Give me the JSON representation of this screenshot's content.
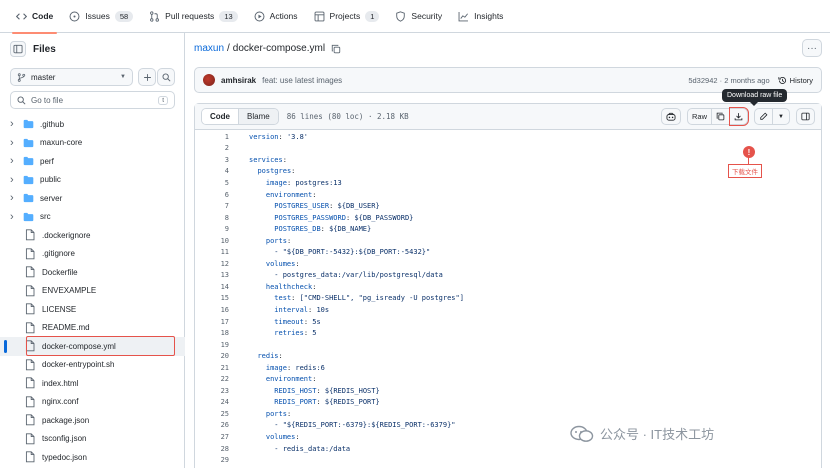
{
  "tabs": [
    {
      "label": "Code",
      "icon": "code-icon",
      "selected": true
    },
    {
      "label": "Issues",
      "icon": "issue-icon",
      "count": "58"
    },
    {
      "label": "Pull requests",
      "icon": "pull-request-icon",
      "count": "13"
    },
    {
      "label": "Actions",
      "icon": "play-icon"
    },
    {
      "label": "Projects",
      "icon": "table-icon",
      "count": "1"
    },
    {
      "label": "Security",
      "icon": "shield-icon"
    },
    {
      "label": "Insights",
      "icon": "graph-icon"
    }
  ],
  "sidebar": {
    "title": "Files",
    "branch": "master",
    "goto_placeholder": "Go to file",
    "goto_shortcut": "t",
    "items": [
      {
        "name": ".github",
        "type": "dir"
      },
      {
        "name": "maxun-core",
        "type": "dir"
      },
      {
        "name": "perf",
        "type": "dir"
      },
      {
        "name": "public",
        "type": "dir"
      },
      {
        "name": "server",
        "type": "dir"
      },
      {
        "name": "src",
        "type": "dir"
      },
      {
        "name": ".dockerignore",
        "type": "file"
      },
      {
        "name": ".gitignore",
        "type": "file"
      },
      {
        "name": "Dockerfile",
        "type": "file"
      },
      {
        "name": "ENVEXAMPLE",
        "type": "file"
      },
      {
        "name": "LICENSE",
        "type": "file"
      },
      {
        "name": "README.md",
        "type": "file"
      },
      {
        "name": "docker-compose.yml",
        "type": "file",
        "active": true
      },
      {
        "name": "docker-entrypoint.sh",
        "type": "file"
      },
      {
        "name": "index.html",
        "type": "file"
      },
      {
        "name": "nginx.conf",
        "type": "file"
      },
      {
        "name": "package.json",
        "type": "file"
      },
      {
        "name": "tsconfig.json",
        "type": "file"
      },
      {
        "name": "typedoc.json",
        "type": "file"
      }
    ]
  },
  "breadcrumb": {
    "repo": "maxun",
    "sep": "/",
    "file": "docker-compose.yml"
  },
  "commit": {
    "user": "amhsirak",
    "message": "feat: use latest images",
    "meta": "5d32942 · 2 months ago",
    "history_label": "History"
  },
  "code_header": {
    "code_tab": "Code",
    "blame_tab": "Blame",
    "info": "86 lines (80 loc) · 2.18 KB",
    "raw_label": "Raw",
    "tooltip": "Download raw file"
  },
  "annotation": {
    "marker": "!",
    "label": "下载文件"
  },
  "code_lines": [
    {
      "n": "1",
      "t": "version: '3.8'"
    },
    {
      "n": "2",
      "t": ""
    },
    {
      "n": "3",
      "t": "services:"
    },
    {
      "n": "4",
      "t": "  postgres:"
    },
    {
      "n": "5",
      "t": "    image: postgres:13"
    },
    {
      "n": "6",
      "t": "    environment:"
    },
    {
      "n": "7",
      "t": "      POSTGRES_USER: ${DB_USER}"
    },
    {
      "n": "8",
      "t": "      POSTGRES_PASSWORD: ${DB_PASSWORD}"
    },
    {
      "n": "9",
      "t": "      POSTGRES_DB: ${DB_NAME}"
    },
    {
      "n": "10",
      "t": "    ports:"
    },
    {
      "n": "11",
      "t": "      - \"${DB_PORT:-5432}:${DB_PORT:-5432}\""
    },
    {
      "n": "12",
      "t": "    volumes:"
    },
    {
      "n": "13",
      "t": "      - postgres_data:/var/lib/postgresql/data"
    },
    {
      "n": "14",
      "t": "    healthcheck:"
    },
    {
      "n": "15",
      "t": "      test: [\"CMD-SHELL\", \"pg_isready -U postgres\"]"
    },
    {
      "n": "16",
      "t": "      interval: 10s"
    },
    {
      "n": "17",
      "t": "      timeout: 5s"
    },
    {
      "n": "18",
      "t": "      retries: 5"
    },
    {
      "n": "19",
      "t": ""
    },
    {
      "n": "20",
      "t": "  redis:"
    },
    {
      "n": "21",
      "t": "    image: redis:6"
    },
    {
      "n": "22",
      "t": "    environment:"
    },
    {
      "n": "23",
      "t": "      REDIS_HOST: ${REDIS_HOST}"
    },
    {
      "n": "24",
      "t": "      REDIS_PORT: ${REDIS_PORT}"
    },
    {
      "n": "25",
      "t": "    ports:"
    },
    {
      "n": "26",
      "t": "      - \"${REDIS_PORT:-6379}:${REDIS_PORT:-6379}\""
    },
    {
      "n": "27",
      "t": "    volumes:"
    },
    {
      "n": "28",
      "t": "      - redis_data:/data"
    },
    {
      "n": "29",
      "t": ""
    }
  ],
  "watermark": "公众号 · IT技术工坊",
  "colors": {
    "accent": "#0969da",
    "tab_underline": "#fd8c73",
    "highlight": "#e5534b"
  }
}
